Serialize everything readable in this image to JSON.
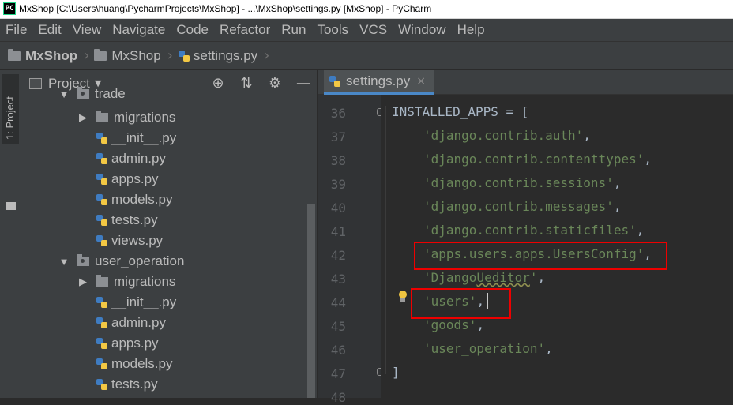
{
  "window": {
    "logo": "PC",
    "title": "MxShop [C:\\Users\\huang\\PycharmProjects\\MxShop] - ...\\MxShop\\settings.py [MxShop] - PyCharm"
  },
  "menu": {
    "file": "File",
    "edit": "Edit",
    "view": "View",
    "navigate": "Navigate",
    "code": "Code",
    "refactor": "Refactor",
    "run": "Run",
    "tools": "Tools",
    "vcs": "VCS",
    "window": "Window",
    "help": "Help"
  },
  "breadcrumb": {
    "root": "MxShop",
    "folder": "MxShop",
    "file": "settings.py"
  },
  "toolstrip": {
    "tab": "1: Project"
  },
  "project": {
    "title": "Project",
    "tools": {
      "locate": "⊕",
      "collapse": "⇅",
      "settings": "⚙",
      "hide": "—"
    },
    "tree": {
      "trade": "trade",
      "trade_migrations": "migrations",
      "trade_init": "__init__.py",
      "trade_admin": "admin.py",
      "trade_apps": "apps.py",
      "trade_models": "models.py",
      "trade_tests": "tests.py",
      "trade_views": "views.py",
      "user_operation": "user_operation",
      "uo_migrations": "migrations",
      "uo_init": "__init__.py",
      "uo_admin": "admin.py",
      "uo_apps": "apps.py",
      "uo_models": "models.py",
      "uo_tests": "tests.py"
    }
  },
  "editor": {
    "tab": "settings.py",
    "tab_close": "×",
    "line_numbers": [
      "36",
      "37",
      "38",
      "39",
      "40",
      "41",
      "42",
      "43",
      "44",
      "45",
      "46",
      "47",
      "48"
    ],
    "lines": {
      "l36": "INSTALLED_APPS = [",
      "l37": "'django.contrib.auth'",
      "l38": "'django.contrib.contenttypes'",
      "l39": "'django.contrib.sessions'",
      "l40": "'django.contrib.messages'",
      "l41": "'django.contrib.staticfiles'",
      "l42": "'apps.users.apps.UsersConfig'",
      "l43a": "'Django",
      "l43b": "Ueditor",
      "l43c": "'",
      "l44": "'users'",
      "l45": "'goods'",
      "l46": "'user_operation'",
      "l47": "]",
      "comma": ","
    }
  }
}
